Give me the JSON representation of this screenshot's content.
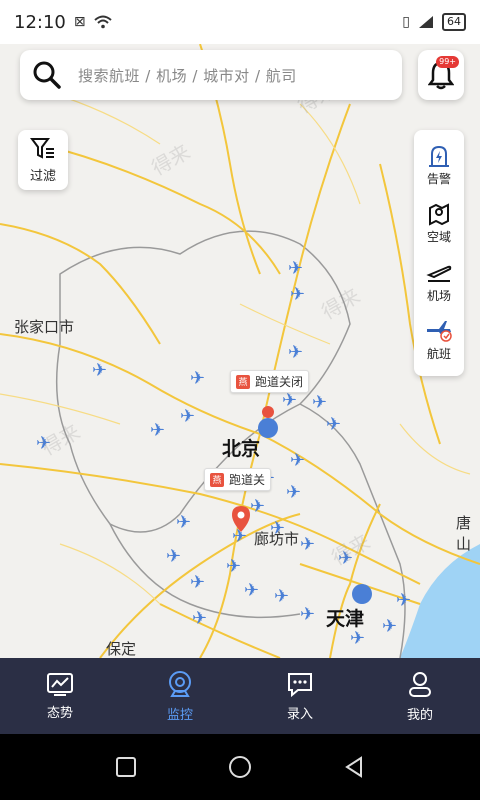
{
  "status_bar": {
    "time": "12:10",
    "battery": "64"
  },
  "search": {
    "placeholder": "搜索航班 / 机场 / 城市对 / 航司"
  },
  "notifications": {
    "badge": "99+"
  },
  "filter": {
    "label": "过滤"
  },
  "right_panel": {
    "items": [
      {
        "label": "告警",
        "icon": "alert-icon"
      },
      {
        "label": "空域",
        "icon": "airspace-icon"
      },
      {
        "label": "机场",
        "icon": "airport-icon"
      },
      {
        "label": "航班",
        "icon": "flight-icon"
      }
    ]
  },
  "map": {
    "labels": {
      "zhangjiakou": "张家口市",
      "beijing": "北京",
      "langfang": "廊坊市",
      "tianjin": "天津",
      "baoding": "保定",
      "tangshan": "唐山"
    },
    "closures": [
      {
        "text": "跑道关闭",
        "icon_text": "燕"
      },
      {
        "text": "跑道关",
        "icon_text": "燕"
      }
    ],
    "watermark": "得来"
  },
  "tabs": [
    {
      "label": "态势",
      "icon": "situation-icon",
      "active": false
    },
    {
      "label": "监控",
      "icon": "monitor-icon",
      "active": true
    },
    {
      "label": "录入",
      "icon": "input-icon",
      "active": false
    },
    {
      "label": "我的",
      "icon": "profile-icon",
      "active": false
    }
  ],
  "colors": {
    "tab_bar_bg": "#2b2f45",
    "active_tab": "#5b9cf5",
    "plane": "#4a7fd6",
    "road": "#f3c63c",
    "water": "#9fd3f5",
    "closure": "#e8533f"
  }
}
